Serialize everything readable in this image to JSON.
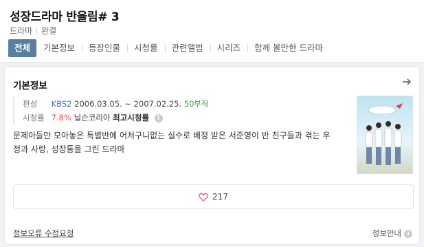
{
  "header": {
    "title": "성장드라마 반올림# 3",
    "genre": "드라마",
    "status": "완결"
  },
  "tabs": [
    {
      "label": "전체",
      "active": true
    },
    {
      "label": "기본정보"
    },
    {
      "label": "등장인물"
    },
    {
      "label": "시청률"
    },
    {
      "label": "관련앨범"
    },
    {
      "label": "시리즈"
    },
    {
      "label": "함께 볼만한 드라마"
    }
  ],
  "info": {
    "section_title": "기본정보",
    "broadcast_label": "편성",
    "channel": "KBS2",
    "period": "2006.03.05. ~ 2007.02.25.",
    "episodes": "50부작",
    "rating_label": "시청률",
    "rating": "7.8%",
    "rating_source": "닐슨코리아",
    "rating_note": "최고시청률",
    "description": "문제아들만 모아놓은 특별반에 어처구니없는 실수로 배정 받은 서준영이 반 친구들과 겪는 우정과 사랑, 성장통을 그린 드라마"
  },
  "like": {
    "count": "217"
  },
  "footer": {
    "report_link": "정보오류 수정요청",
    "info_label": "정보안내"
  },
  "icons": {
    "arrow": "arrow-right-icon",
    "heart": "heart-icon",
    "info": "info-icon"
  },
  "colors": {
    "active_tab": "#5a7f9e",
    "channel": "#3b6fb5",
    "episodes": "#2ea043",
    "rating": "#e94b4b"
  }
}
